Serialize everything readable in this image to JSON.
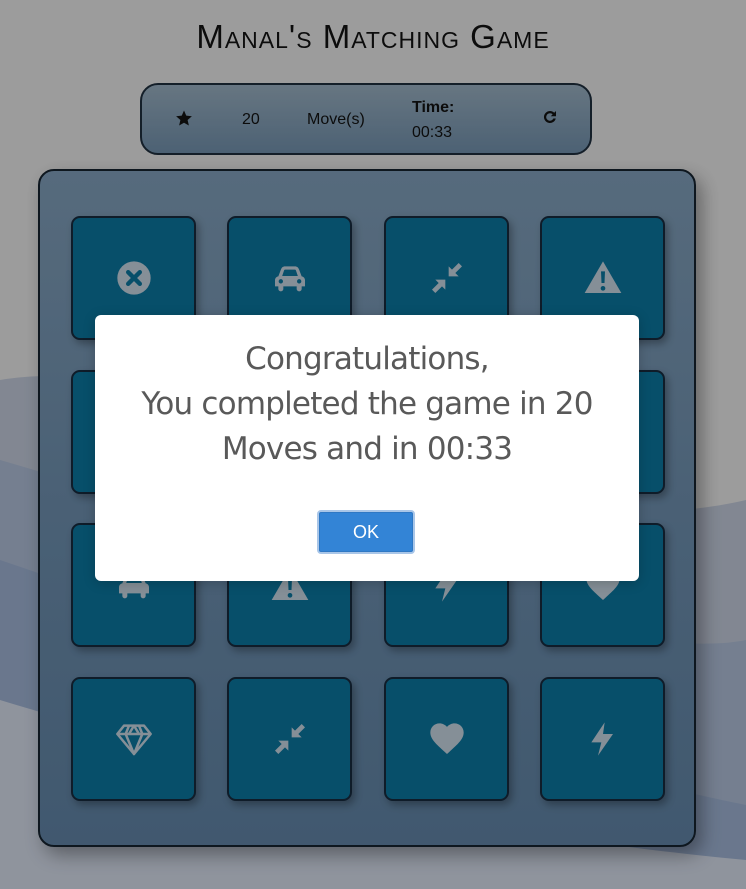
{
  "title": "Manal's Matching Game",
  "score_panel": {
    "star_icon": "star-icon",
    "moves_count": "20",
    "moves_label": "Move(s)",
    "time_label": "Time:",
    "time_value": "00:33",
    "restart_icon": "refresh-icon"
  },
  "deck": {
    "cards": [
      {
        "icon": "times-circle"
      },
      {
        "icon": "car"
      },
      {
        "icon": "compress"
      },
      {
        "icon": "warning"
      },
      {
        "icon": "hidden"
      },
      {
        "icon": "hidden"
      },
      {
        "icon": "hidden"
      },
      {
        "icon": "hidden"
      },
      {
        "icon": "car"
      },
      {
        "icon": "warning"
      },
      {
        "icon": "bolt"
      },
      {
        "icon": "heart"
      },
      {
        "icon": "diamond"
      },
      {
        "icon": "compress"
      },
      {
        "icon": "heart"
      },
      {
        "icon": "bolt"
      }
    ]
  },
  "modal": {
    "line1": "Congratulations,",
    "line2": "You completed the game in 20",
    "line3": "Moves and in 00:33",
    "ok_label": "OK",
    "ok_color": "#3384d6"
  }
}
